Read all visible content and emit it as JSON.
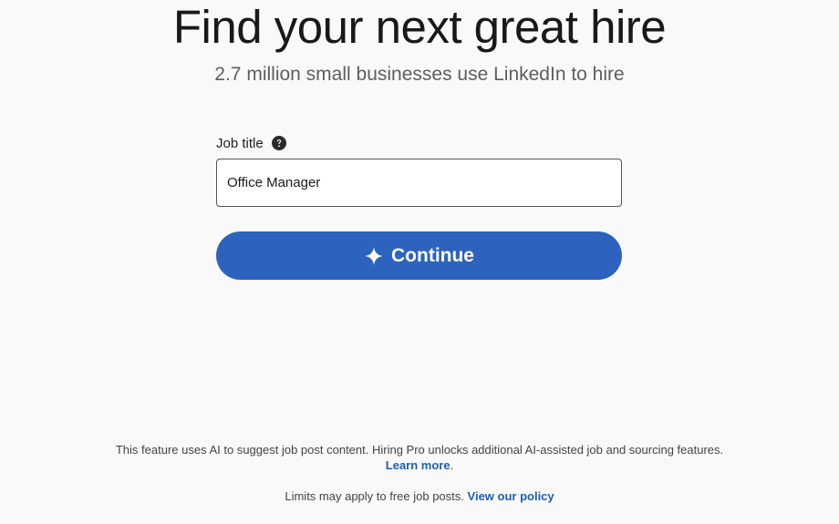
{
  "header": {
    "title": "Find your next great hire",
    "subtitle": "2.7 million small businesses use LinkedIn to hire"
  },
  "form": {
    "job_title_label": "Job title",
    "help_icon": "question-circle-icon",
    "job_title_value": "Office Manager",
    "continue_label": "Continue",
    "continue_icon": "sparkle-icon"
  },
  "footer": {
    "ai_note": "This feature uses AI to suggest job post content. Hiring Pro unlocks additional AI-assisted job and sourcing features.",
    "learn_more_label": "Learn more",
    "learn_more_suffix": ".",
    "limits_text": "Limits may apply to free job posts.",
    "policy_link_label": "View our policy"
  },
  "colors": {
    "primary_button": "#2d63be",
    "link": "#1d5fb0",
    "background": "#f9f9f9"
  }
}
